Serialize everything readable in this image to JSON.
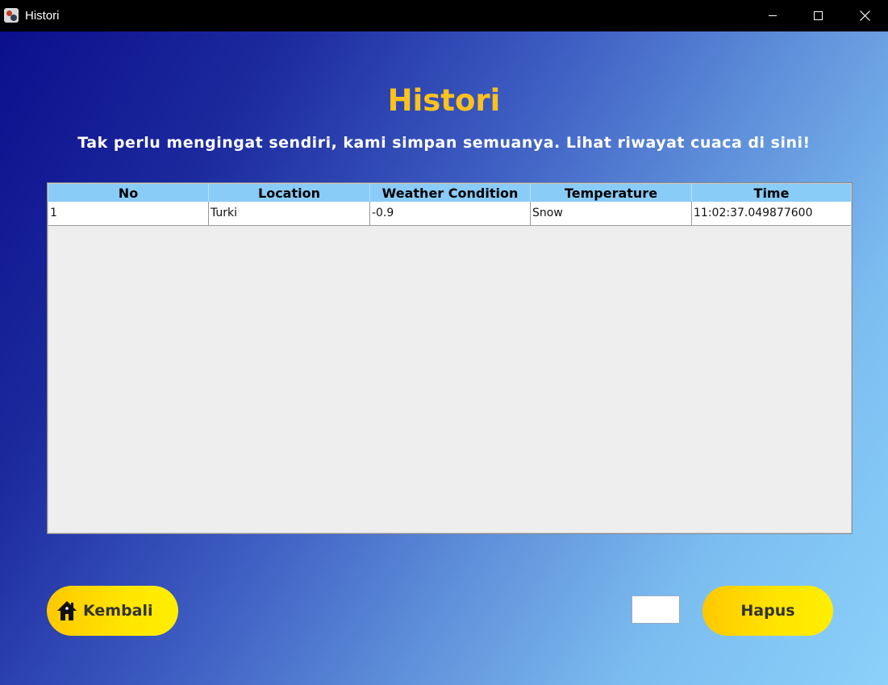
{
  "window": {
    "title": "Histori",
    "app_icon": "java-app-icon",
    "controls": [
      "minimize-icon",
      "maximize-icon",
      "close-icon"
    ]
  },
  "header": {
    "title": "Histori",
    "subtitle": "Tak perlu mengingat sendiri, kami simpan semuanya. Lihat riwayat cuaca di sini!",
    "title_color": "#ffc21c"
  },
  "table": {
    "columns": [
      "No",
      "Location",
      "Weather Condition",
      "Temperature",
      "Time"
    ],
    "rows": [
      [
        "1",
        "Turki",
        "-0.9",
        "Snow",
        "11:02:37.049877600"
      ]
    ],
    "header_color": "#89ccf7"
  },
  "buttons": {
    "back_label": "Kembali",
    "back_icon": "home-icon",
    "delete_label": "Hapus",
    "color": "#ffe600"
  },
  "delete_input": {
    "value": ""
  }
}
